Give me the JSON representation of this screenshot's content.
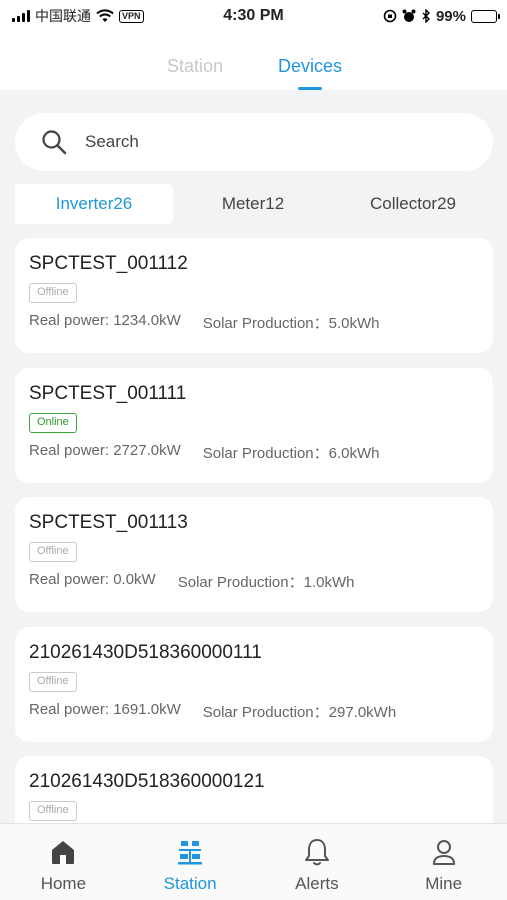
{
  "status_bar": {
    "carrier": "中国联通",
    "vpn": "VPN",
    "time": "4:30 PM",
    "battery": "99%"
  },
  "top_tabs": {
    "station": "Station",
    "devices": "Devices",
    "active": "devices"
  },
  "search": {
    "placeholder": "Search"
  },
  "device_tabs": [
    {
      "label": "Inverter26",
      "active": true
    },
    {
      "label": "Meter12",
      "active": false
    },
    {
      "label": "Collector29",
      "active": false
    }
  ],
  "devices": [
    {
      "name": "SPCTEST_001112",
      "status": "Offline",
      "real_power": "Real power: 1234.0kW",
      "solar": "Solar Production：5.0kWh"
    },
    {
      "name": "SPCTEST_001111",
      "status": "Online",
      "real_power": "Real power: 2727.0kW",
      "solar": "Solar Production：6.0kWh"
    },
    {
      "name": "SPCTEST_001113",
      "status": "Offline",
      "real_power": "Real power: 0.0kW",
      "solar": "Solar Production：1.0kWh"
    },
    {
      "name": "210261430D518360000111",
      "status": "Offline",
      "real_power": "Real power: 1691.0kW",
      "solar": "Solar Production：297.0kWh"
    },
    {
      "name": "210261430D518360000121",
      "status": "Offline",
      "real_power": "",
      "solar": ""
    }
  ],
  "bottom_nav": {
    "home": "Home",
    "station": "Station",
    "alerts": "Alerts",
    "mine": "Mine",
    "active": "station"
  },
  "colors": {
    "accent": "#1f96dd",
    "online": "#37a53a",
    "offline": "#c9c9c9",
    "background": "#f2f3f5"
  }
}
